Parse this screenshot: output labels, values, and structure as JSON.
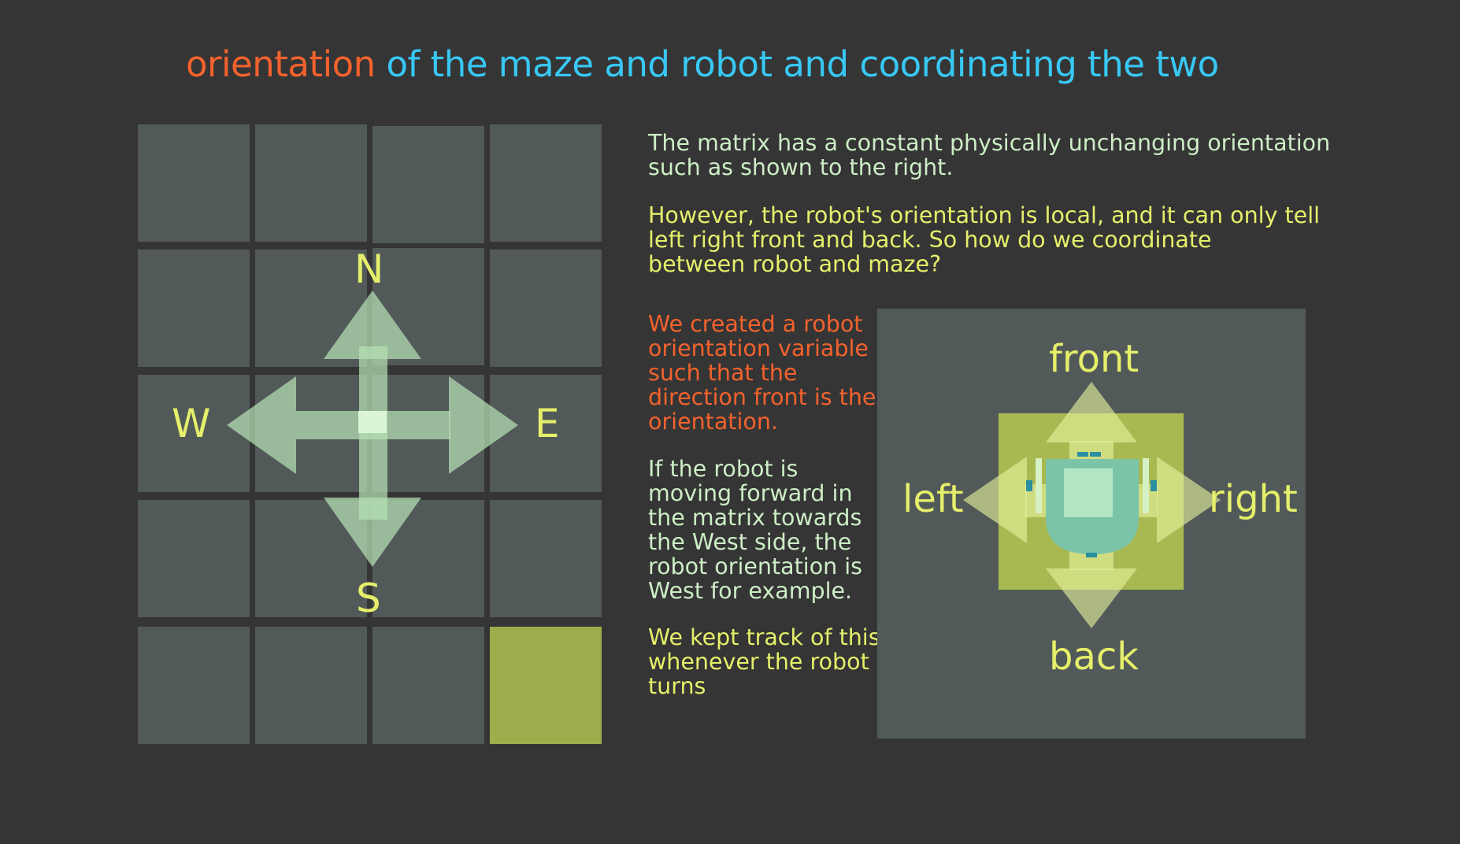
{
  "title": {
    "accent": "orientation",
    "rest": " of the maze and robot and coordinating the two"
  },
  "maze": {
    "rows": 5,
    "cols": 4,
    "goal_cell": {
      "row": 4,
      "col": 3
    }
  },
  "compass": {
    "north": "N",
    "south": "S",
    "west": "W",
    "east": "E"
  },
  "text": {
    "p1": [
      "The matrix has a constant physically unchanging orientation",
      "such as shown to the right."
    ],
    "p2": [
      "However, the robot's orientation is local, and it can only tell",
      "left right front and back. So how do we coordinate",
      "between robot and maze?"
    ],
    "p3": [
      "We created a robot",
      "orientation variable",
      "such that the",
      "direction front is the",
      "orientation."
    ],
    "p4": [
      "If the robot is",
      "moving forward in",
      "the matrix towards",
      "the West side, the",
      "robot orientation is",
      "West for example."
    ],
    "p5": [
      "We kept track of this",
      "whenever the robot",
      "turns"
    ]
  },
  "robot": {
    "front": "front",
    "back": "back",
    "left": "left",
    "right": "right"
  },
  "colors": {
    "background": "#353535",
    "cell": "#525a59",
    "goal": "#9cae4b",
    "title_accent": "#f4622d",
    "title_rest": "#38c8f4",
    "label_yellow": "#e6ef6a",
    "text_green": "#cdeec6",
    "arrow": "#b6e0b4"
  }
}
